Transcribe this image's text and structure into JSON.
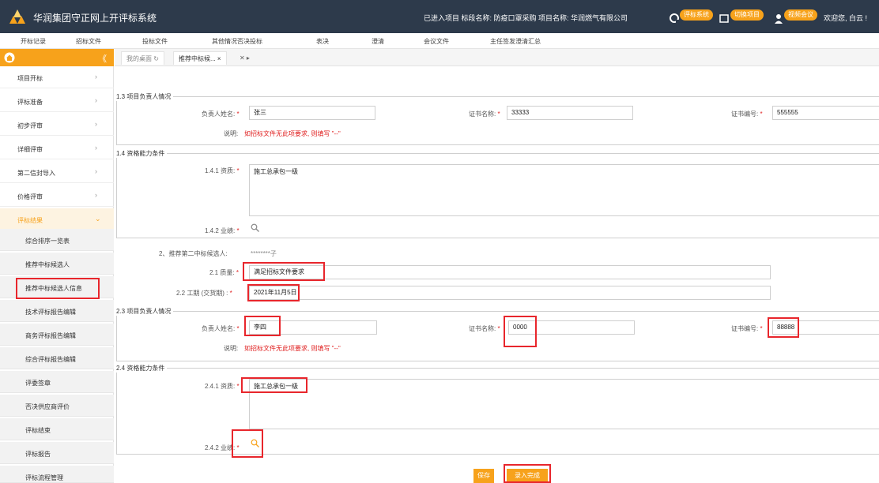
{
  "app": {
    "title": "华润集团守正网上开评标系统"
  },
  "header": {
    "project_info": "已进入项目 标段名称: 防疫口罩采购   项目名称: 华润燃气有限公司",
    "btn_eval": "评标系统",
    "btn_switch": "切换项目",
    "btn_video": "视频会议",
    "welcome": "欢迎您, 白云 !"
  },
  "menu": [
    "开标记录",
    "招标文件",
    "投标文件",
    "其他情况否决投标",
    "表决",
    "澄清",
    "会议文件",
    "主任签发澄清汇总"
  ],
  "sidebar": {
    "collapse_glyph": "《",
    "items": [
      {
        "label": "项目开标",
        "arrow": "›"
      },
      {
        "label": "评标准备",
        "arrow": "›"
      },
      {
        "label": "初步评审",
        "arrow": "›"
      },
      {
        "label": "详细评审",
        "arrow": "›"
      },
      {
        "label": "第二信封导入",
        "arrow": "›"
      },
      {
        "label": "价格评审",
        "arrow": "›"
      },
      {
        "label": "评标结果",
        "arrow": "⌄"
      }
    ],
    "sub_items": [
      "综合排序一览表",
      "推荐中标候选人",
      "推荐中标候选人信息",
      "技术评标报告编辑",
      "商务评标报告编辑",
      "综合评标报告编辑",
      "评委签章",
      "否决供应商评价",
      "评标结束",
      "评标报告",
      "评标流程管理"
    ]
  },
  "tabs": {
    "home": "我的桌面 ↻",
    "current": "推荐中标候... ×",
    "close_glyph": "✕ ▸"
  },
  "form": {
    "s13_legend": "1.3 项目负责人情况",
    "s13_name_label": "负责人姓名:",
    "s13_name_value": "张三",
    "s13_cert_label": "证书名称:",
    "s13_cert_value": "33333",
    "s13_certno_label": "证书编号:",
    "s13_certno_value": "555555",
    "s13_note_label": "说明:",
    "s13_note": "如招标文件无此项要求, 则填写 \"--\"",
    "s14_legend": "1.4 资格能力条件",
    "s141_label": "1.4.1 资质:",
    "s141_value": "施工总承包一级",
    "s142_label": "1.4.2 业绩:",
    "c2_label": "2、推荐第二中标候选人:",
    "c2_value": "********子",
    "c21_label": "2.1 质量:",
    "c21_value": "满足招标文件要求",
    "c22_label": "2.2 工期 (交货期) :",
    "c22_value": "2021年11月5日",
    "s23_legend": "2.3 项目负责人情况",
    "s23_name_label": "负责人姓名:",
    "s23_name_value": "李四",
    "s23_cert_label": "证书名称:",
    "s23_cert_value": "0000",
    "s23_certno_label": "证书编号:",
    "s23_certno_value": "88888",
    "s23_note_label": "说明:",
    "s23_note": "如招标文件无此项要求, 则填写 \"--\"",
    "s24_legend": "2.4 资格能力条件",
    "s241_label": "2.4.1 资质:",
    "s241_value": "施工总承包一级",
    "s242_label": "2.4.2 业绩:",
    "required_mark": "*"
  },
  "buttons": {
    "save": "保存",
    "submit": "录入完成"
  },
  "colors": {
    "accent": "#f7a21b",
    "topbar": "#2d3a4b",
    "highlight": "#e8262c"
  }
}
